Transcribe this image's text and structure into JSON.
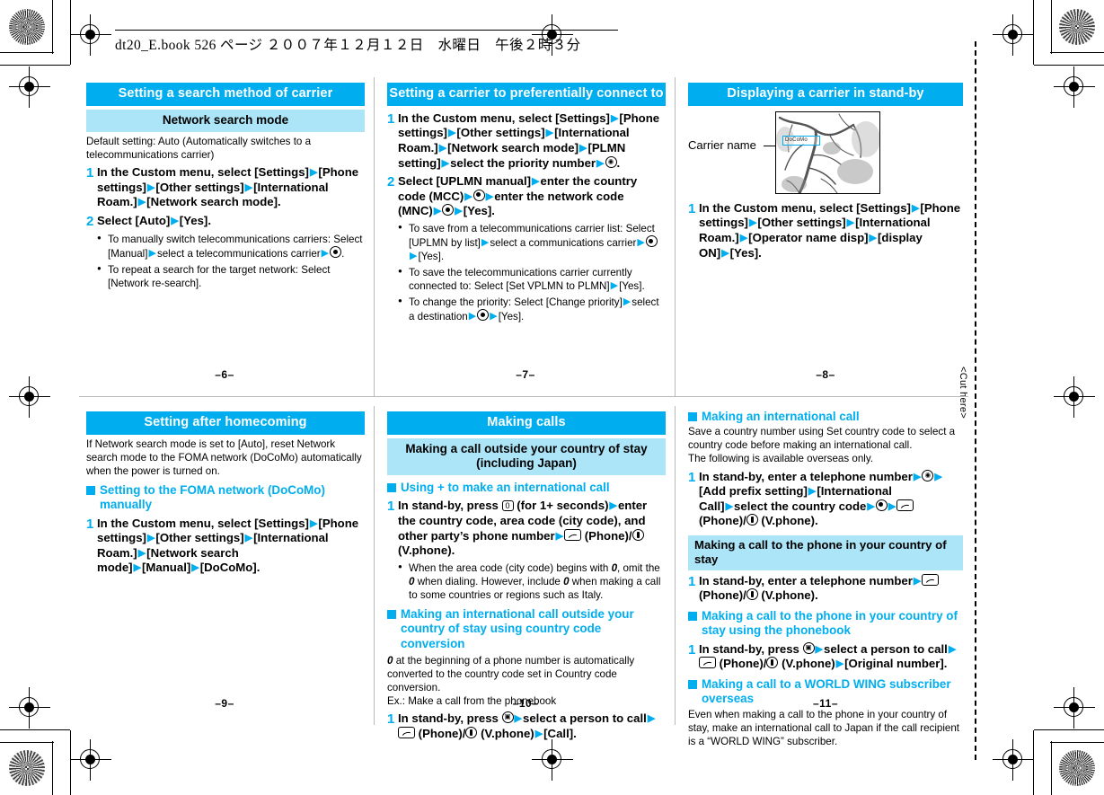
{
  "header": {
    "text": "dt20_E.book  526 ページ  ２００７年１２月１２日　水曜日　午後２時３分"
  },
  "cut_marker": {
    "label": "<Cut here>"
  },
  "folios": {
    "p6": "–6–",
    "p7": "–7–",
    "p8": "–8–",
    "p9": "–9–",
    "p10": "–10–",
    "p11": "–11–"
  },
  "colors": {
    "accent": "#00aeef",
    "accent_light": "#ace5f7",
    "text": "#000000"
  },
  "panels": {
    "p6": {
      "title": "Setting a search method of carrier",
      "subtitle": "Network search mode",
      "intro": "Default setting: Auto (Automatically switches to a telecommunications carrier)",
      "step1_num": "1",
      "step1_a": "In the Custom menu, select [Settings]",
      "step1_b": "[Phone settings]",
      "step1_c": "[Other settings]",
      "step1_d": "[International Roam.]",
      "step1_e": "[Network search mode].",
      "step2_num": "2",
      "step2_a": "Select [Auto]",
      "step2_b": "[Yes].",
      "note1_a": "To manually switch telecommunications carriers: Select [Manual]",
      "note1_b": "select a telecommunications carrier",
      "note1_c": ".",
      "note2": "To repeat a search for the target network: Select [Network re-search]."
    },
    "p7": {
      "title": "Setting a carrier to preferentially connect to",
      "step1_num": "1",
      "step1_a": "In the Custom menu, select [Settings]",
      "step1_b": "[Phone settings]",
      "step1_c": "[Other settings]",
      "step1_d": "[International Roam.]",
      "step1_e": "[Network search mode]",
      "step1_f": "[PLMN setting]",
      "step1_g": "select the priority number",
      "step1_h": ".",
      "step2_num": "2",
      "step2_a": "Select [UPLMN manual]",
      "step2_b": "enter the country code (MCC)",
      "step2_c": "enter the network code (MNC)",
      "step2_d": "[Yes].",
      "note1_a": "To save from a telecommunications carrier list: Select [UPLMN by list]",
      "note1_b": "select a communications carrier",
      "note1_c": "[Yes].",
      "note2_a": "To save the telecommunications carrier currently connected to: Select [Set VPLMN to PLMN]",
      "note2_b": "[Yes].",
      "note3_a": "To change the priority: Select [Change priority]",
      "note3_b": "select a destination",
      "note3_c": "[Yes]."
    },
    "p8": {
      "title": "Displaying a carrier in stand-by",
      "callout": "Carrier name",
      "carrier_text": "DoCoMo",
      "step1_num": "1",
      "step1_a": "In the Custom menu, select [Settings]",
      "step1_b": "[Phone settings]",
      "step1_c": "[Other settings]",
      "step1_d": "[International Roam.]",
      "step1_e": "[Operator name disp]",
      "step1_f": "[display ON]",
      "step1_g": "[Yes]."
    },
    "p9": {
      "title": "Setting after homecoming",
      "intro": "If Network search mode is set to [Auto], reset Network search mode to the FOMA network (DoCoMo) automatically when the power is turned on.",
      "head1": "Setting to the FOMA network (DoCoMo) manually",
      "step1_num": "1",
      "step1_a": "In the Custom menu, select [Settings]",
      "step1_b": "[Phone settings]",
      "step1_c": "[Other settings]",
      "step1_d": "[International Roam.]",
      "step1_e": "[Network search mode]",
      "step1_f": "[Manual]",
      "step1_g": "[DoCoMo]."
    },
    "p10": {
      "title": "Making calls",
      "subtitle": "Making a call outside your country of stay (including Japan)",
      "head1": "Using + to make an international call",
      "step1_num": "1",
      "step1_a": "In stand-by, press",
      "step1_key": "0",
      "step1_b": "(for 1+ seconds)",
      "step1_c": "enter the country code, area code (city code), and other party’s phone number",
      "step1_d": "(Phone)/",
      "step1_e": "(V.phone).",
      "note1_a": "When the area code (city code) begins with",
      "note1_zero1": "0",
      "note1_b": ", omit the",
      "note1_zero2": "0",
      "note1_c": "when dialing. However, include",
      "note1_zero3": "0",
      "note1_d": "when making a call to some countries or regions such as Italy.",
      "head2": "Making an international call outside your country of stay using country code conversion",
      "body_zero": "0",
      "body_a": "at the beginning of a phone number is automatically converted to the country code set in Country code conversion.",
      "body_b": "Ex.: Make a call from the phonebook",
      "step2_num": "1",
      "step2_a": "In stand-by, press",
      "step2_b": "select a person to call",
      "step2_c": "(Phone)/",
      "step2_d": "(V.phone)",
      "step2_e": "[Call]."
    },
    "p11": {
      "head1": "Making an international call",
      "intro1": "Save a country number using Set country code to select a country code before making an international call.",
      "intro2": "The following is available overseas only.",
      "step1_num": "1",
      "step1_a": "In stand-by, enter a telephone number",
      "step1_b": "[Add prefix setting]",
      "step1_c": "[International Call]",
      "step1_d": "select the country code",
      "step1_e": "(Phone)/",
      "step1_f": "(V.phone).",
      "band1": "Making a call to the phone in your country of stay",
      "step2_num": "1",
      "step2_a": "In stand-by, enter a telephone number",
      "step2_b": "(Phone)/",
      "step2_c": "(V.phone).",
      "head2": "Making a call to the phone in your country of stay using the phonebook",
      "step3_num": "1",
      "step3_a": "In stand-by, press",
      "step3_b": "select a person to call",
      "step3_c": "(Phone)/",
      "step3_d": "(V.phone)",
      "step3_e": "[Original number].",
      "head3": "Making a call to a WORLD WING subscriber overseas",
      "outro": "Even when making a call to the phone in your country of stay, make an international call to Japan if the call recipient is a “WORLD WING” subscriber."
    }
  }
}
